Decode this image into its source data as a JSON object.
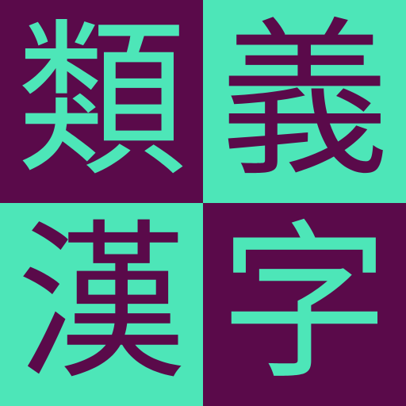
{
  "colors": {
    "dark": "#5a0a4a",
    "light": "#4de6b8"
  },
  "tiles": [
    {
      "char": "類",
      "background": "#5a0a4a",
      "color": "#4de6b8"
    },
    {
      "char": "義",
      "background": "#4de6b8",
      "color": "#5a0a4a"
    },
    {
      "char": "漢",
      "background": "#4de6b8",
      "color": "#5a0a4a"
    },
    {
      "char": "字",
      "background": "#5a0a4a",
      "color": "#4de6b8"
    }
  ]
}
